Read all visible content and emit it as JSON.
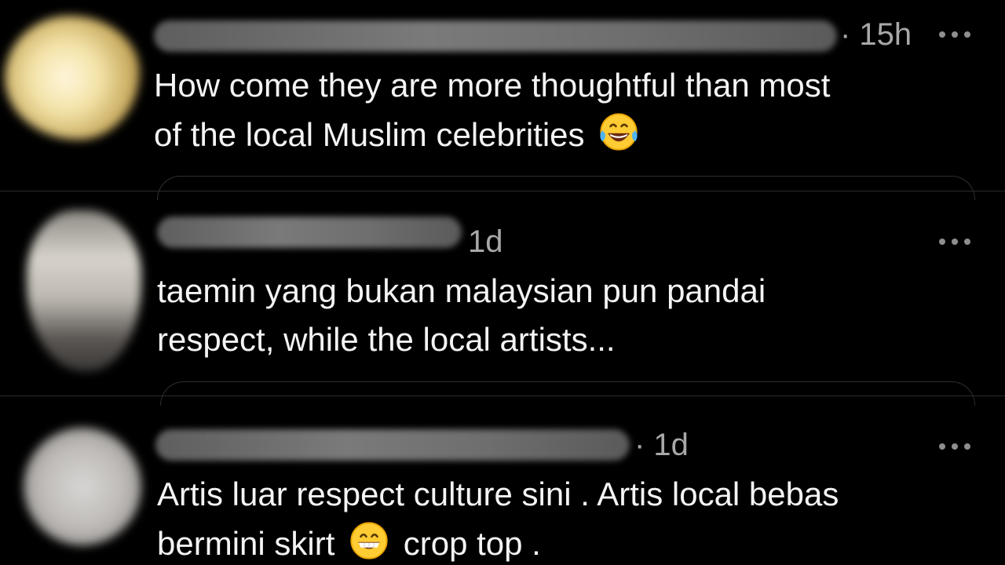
{
  "comments": [
    {
      "timestamp": "· 15h",
      "text_line1": "How come they are more thoughtful than most",
      "text_line2": "of the local Muslim celebrities",
      "emoji": "face-with-tears-of-joy"
    },
    {
      "timestamp": "1d",
      "text_line1": "taemin yang bukan malaysian pun pandai",
      "text_line2": "respect, while the local artists..."
    },
    {
      "timestamp": "· 1d",
      "text_line1": "Artis luar respect culture sini . Artis local bebas",
      "text_line2_a": "bermini skirt",
      "text_line2_b": "crop top .",
      "emoji": "grinning-face-with-smiling-eyes"
    }
  ],
  "icons": {
    "more": "more-horizontal-icon"
  },
  "colors": {
    "background": "#000000",
    "text": "#f4f4f4",
    "meta": "#a8a8a8",
    "divider": "#2a2a2a"
  }
}
